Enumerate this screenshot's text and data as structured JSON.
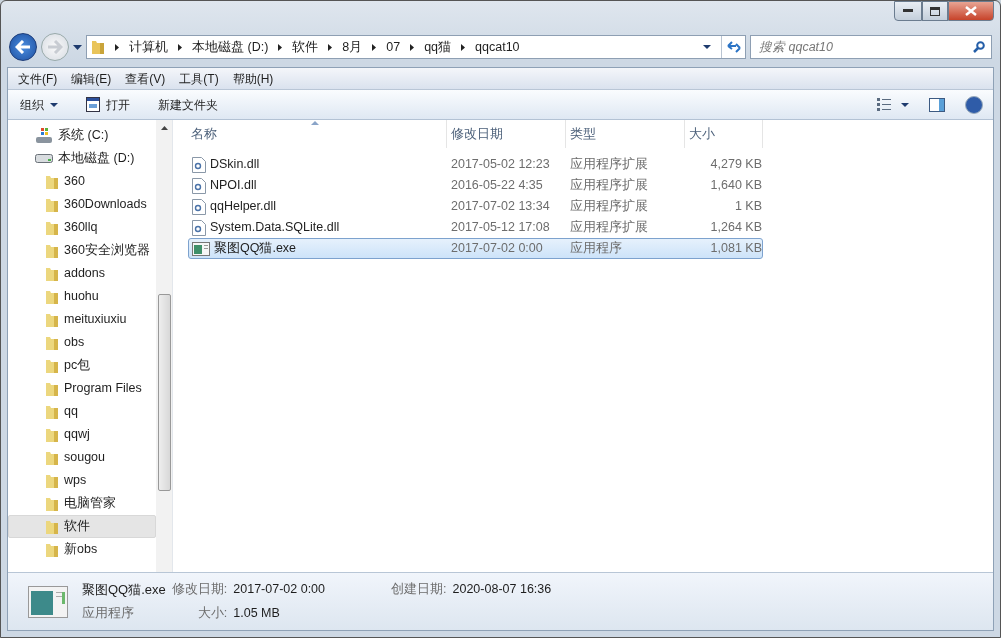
{
  "address": {
    "breadcrumbs": [
      "计算机",
      "本地磁盘 (D:)",
      "软件",
      "8月",
      "07",
      "qq猫",
      "qqcat10"
    ]
  },
  "search": {
    "placeholder": "搜索 qqcat10"
  },
  "menu": [
    "文件(F)",
    "编辑(E)",
    "查看(V)",
    "工具(T)",
    "帮助(H)"
  ],
  "toolbar": [
    {
      "label": "组织",
      "kind": "dropdown"
    },
    {
      "label": "打开",
      "kind": "icon"
    },
    {
      "label": "新建文件夹",
      "kind": "plain"
    }
  ],
  "sidebar": {
    "items": [
      {
        "label": "系统 (C:)",
        "kind": "system-drive",
        "selected": false
      },
      {
        "label": "本地磁盘 (D:)",
        "kind": "drive",
        "selected": false,
        "children": [
          {
            "label": "360",
            "kind": "folder",
            "selected": false
          },
          {
            "label": "360Downloads",
            "kind": "folder",
            "selected": false
          },
          {
            "label": "360llq",
            "kind": "folder",
            "selected": false
          },
          {
            "label": "360安全浏览器",
            "kind": "folder",
            "selected": false
          },
          {
            "label": "addons",
            "kind": "folder",
            "selected": false
          },
          {
            "label": "huohu",
            "kind": "folder",
            "selected": false
          },
          {
            "label": "meituxiuxiu",
            "kind": "folder",
            "selected": false
          },
          {
            "label": "obs",
            "kind": "folder",
            "selected": false
          },
          {
            "label": "pc包",
            "kind": "folder",
            "selected": false
          },
          {
            "label": "Program Files",
            "kind": "folder",
            "selected": false
          },
          {
            "label": "qq",
            "kind": "folder",
            "selected": false
          },
          {
            "label": "qqwj",
            "kind": "folder",
            "selected": false
          },
          {
            "label": "sougou",
            "kind": "folder",
            "selected": false
          },
          {
            "label": "wps",
            "kind": "folder",
            "selected": false
          },
          {
            "label": "电脑管家",
            "kind": "folder",
            "selected": false
          },
          {
            "label": "软件",
            "kind": "folder",
            "selected": true
          },
          {
            "label": "新obs",
            "kind": "folder",
            "selected": false
          }
        ]
      }
    ]
  },
  "table": {
    "columns": [
      {
        "label": "名称",
        "sorted": true
      },
      {
        "label": "修改日期",
        "sorted": false
      },
      {
        "label": "类型",
        "sorted": false
      },
      {
        "label": "大小",
        "sorted": false
      }
    ],
    "rows": [
      {
        "kind": "dll",
        "name": "DSkin.dll",
        "date": "2017-05-02 12:23",
        "type": "应用程序扩展",
        "size": "4,279 KB",
        "selected": false
      },
      {
        "kind": "dll",
        "name": "NPOI.dll",
        "date": "2016-05-22 4:35",
        "type": "应用程序扩展",
        "size": "1,640 KB",
        "selected": false
      },
      {
        "kind": "dll",
        "name": "qqHelper.dll",
        "date": "2017-07-02 13:34",
        "type": "应用程序扩展",
        "size": "1 KB",
        "selected": false
      },
      {
        "kind": "dll",
        "name": "System.Data.SQLite.dll",
        "date": "2017-05-12 17:08",
        "type": "应用程序扩展",
        "size": "1,264 KB",
        "selected": false
      },
      {
        "kind": "exe",
        "name": "聚图QQ猫.exe",
        "date": "2017-07-02 0:00",
        "type": "应用程序",
        "size": "1,081 KB",
        "selected": true
      }
    ]
  },
  "details": {
    "name": "聚图QQ猫.exe",
    "type": "应用程序",
    "fields": [
      {
        "label": "修改日期:",
        "value": "2017-07-02 0:00"
      },
      {
        "label": "创建日期:",
        "value": "2020-08-07 16:36"
      },
      {
        "label": "大小:",
        "value": "1.05 MB"
      }
    ]
  }
}
